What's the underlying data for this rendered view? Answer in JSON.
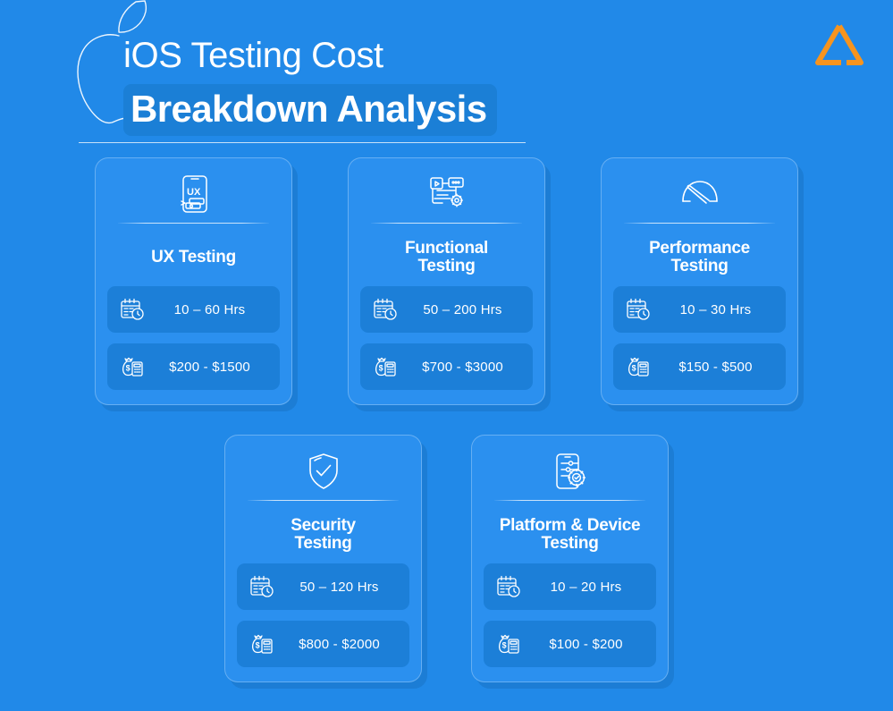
{
  "header": {
    "title_line1": "iOS Testing Cost",
    "title_line2": "Breakdown Analysis",
    "apple_icon": "apple-logo-outline-icon",
    "brand_icon": "triangle-brand-logo-icon"
  },
  "theme": {
    "background": "#2189e8",
    "card_background": "#2b90ef",
    "stat_background": "#1c7fd8",
    "highlight_background": "#1b7fd6",
    "brand_accent": "#f7941e",
    "text": "#ffffff"
  },
  "labels": {
    "hours_icon": "calendar-clock-icon",
    "cost_icon": "money-bag-calculator-icon"
  },
  "cards": [
    {
      "id": "ux-testing",
      "icon": "phone-ux-wireframe-icon",
      "title_lines": [
        "UX Testing"
      ],
      "hours": "10 – 60 Hrs",
      "cost": "$200 - $1500"
    },
    {
      "id": "functional-testing",
      "icon": "browser-gear-icon",
      "title_lines": [
        "Functional",
        "Testing"
      ],
      "hours": "50 – 200 Hrs",
      "cost": "$700 - $3000"
    },
    {
      "id": "performance-testing",
      "icon": "speedometer-icon",
      "title_lines": [
        "Performance",
        "Testing"
      ],
      "hours": "10 – 30 Hrs",
      "cost": "$150 - $500"
    },
    {
      "id": "security-testing",
      "icon": "shield-check-icon",
      "title_lines": [
        "Security",
        "Testing"
      ],
      "hours": "50 – 120 Hrs",
      "cost": "$800 - $2000"
    },
    {
      "id": "platform-device-testing",
      "icon": "phone-settings-gear-icon",
      "title_lines": [
        "Platform & Device",
        "Testing"
      ],
      "hours": "10 – 20 Hrs",
      "cost": "$100 - $200"
    }
  ]
}
